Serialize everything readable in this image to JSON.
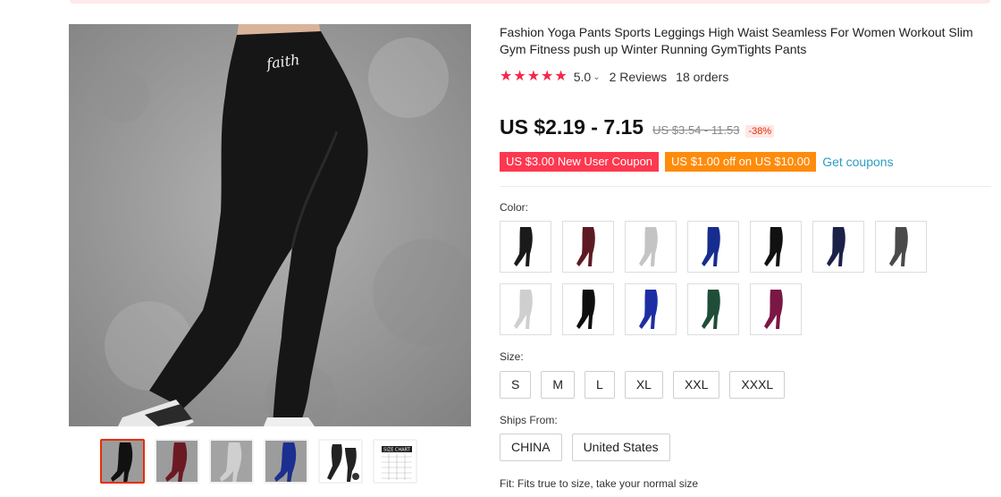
{
  "product": {
    "title": "Fashion Yoga Pants Sports Leggings High Waist Seamless For Women Workout Slim Gym Fitness push up Winter Running GymTights Pants",
    "rating": "5.0",
    "reviews": "2 Reviews",
    "orders": "18 orders",
    "star_count": 5,
    "price": "US $2.19 - 7.15",
    "old_price": "US $3.54 - 11.53",
    "discount": "-38%",
    "coupons": [
      "US $3.00 New User Coupon",
      "US $1.00 off on US $10.00"
    ],
    "get_coupons": "Get coupons"
  },
  "main_image": {
    "waistband_text": "faith"
  },
  "thumbnails": [
    {
      "color": "#111111",
      "selected": true
    },
    {
      "color": "#6b1a24",
      "selected": false
    },
    {
      "color": "#bdbdbd",
      "selected": false
    },
    {
      "color": "#1a2f8f",
      "selected": false
    },
    {
      "color": "#222222",
      "selected": false
    },
    {
      "color": "size-chart",
      "selected": false
    }
  ],
  "size_chart_label": "SIZE CHART",
  "color_label": "Color:",
  "colors": [
    "#1a1a1a",
    "#5e1a22",
    "#c4c4c4",
    "#172c8f",
    "#111111",
    "#1c2148",
    "#4a4a4a",
    "#cfcfcf",
    "#0f0f0f",
    "#1d2ea5",
    "#1f4d38",
    "#7a1744"
  ],
  "size_label": "Size:",
  "sizes": [
    "S",
    "M",
    "L",
    "XL",
    "XXL",
    "XXXL"
  ],
  "ships_label": "Ships From:",
  "ships": [
    "CHINA",
    "United States"
  ],
  "fit": "Fit: Fits true to size, take your normal size",
  "colors_theme": {
    "accent": "#f5264a",
    "price": "#111111",
    "link": "#2e9cc3",
    "coupon_red": "#fd384f",
    "coupon_orange": "#ff8b0a"
  }
}
